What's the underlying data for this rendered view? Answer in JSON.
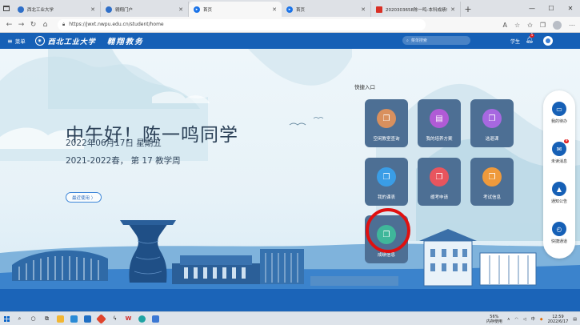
{
  "browser": {
    "tabs": [
      {
        "title": "西北工业大学",
        "active": false,
        "favicon_color": "#2f6fc8"
      },
      {
        "title": "翱翔门户",
        "active": false,
        "favicon_color": "#2f6fc8"
      },
      {
        "title": "首页",
        "active": true,
        "favicon_color": "#1a73e8"
      },
      {
        "title": "首页",
        "active": false,
        "favicon_color": "#1a73e8"
      },
      {
        "title": "2020303658陈一鸣-本科成绩单",
        "active": false,
        "favicon_color": "#d93025"
      }
    ],
    "new_tab": "+",
    "url": "https://jwxt.nwpu.edu.cn/student/home",
    "window_controls": {
      "minimize": "—",
      "maximize": "☐",
      "close": "✕"
    }
  },
  "app": {
    "menu_label": "菜单",
    "school_name": "西北工业大学",
    "system_name": "翱翔教务",
    "search_placeholder": "菜单搜索",
    "role": "学生",
    "notification_count": "5"
  },
  "greeting": {
    "text": "中午好！陈一鸣同学",
    "date": "2022年06月17日  星期五",
    "week": "2021-2022春， 第 17 教学周",
    "recent_button": "最近使用 〉"
  },
  "quick_entry": {
    "title": "快捷入口",
    "items": [
      {
        "label": "空闲教室查询",
        "color": "#d9905e",
        "icon": "copy-icon"
      },
      {
        "label": "我的培养方案",
        "color": "#b05bd6",
        "icon": "book-icon"
      },
      {
        "label": "选退课",
        "color": "#a768e0",
        "icon": "copy-icon"
      },
      {
        "label": "我的课表",
        "color": "#3a9de6",
        "icon": "copy-icon"
      },
      {
        "label": "缓考申请",
        "color": "#e8555e",
        "icon": "copy-icon"
      },
      {
        "label": "考试信息",
        "color": "#ef9a3c",
        "icon": "copy-icon"
      },
      {
        "label": "成绩信息",
        "color": "#3fb79a",
        "icon": "copy-icon"
      }
    ]
  },
  "right_panel": {
    "items": [
      {
        "label": "我的待办",
        "icon": "todo-icon",
        "badge": ""
      },
      {
        "label": "未读消息",
        "icon": "message-icon",
        "badge": "9"
      },
      {
        "label": "通知公告",
        "icon": "bell-icon",
        "badge": ""
      },
      {
        "label": "快捷通道",
        "icon": "clock-icon",
        "badge": ""
      }
    ]
  },
  "taskbar": {
    "zoom": "56%",
    "zoom_sub": "内存使用",
    "time": "12:59",
    "date": "2022/6/17",
    "ime": "中"
  },
  "colors": {
    "header_blue": "#1660b6",
    "tile_bg": "#4d6f94",
    "highlight_red": "#e01010"
  }
}
